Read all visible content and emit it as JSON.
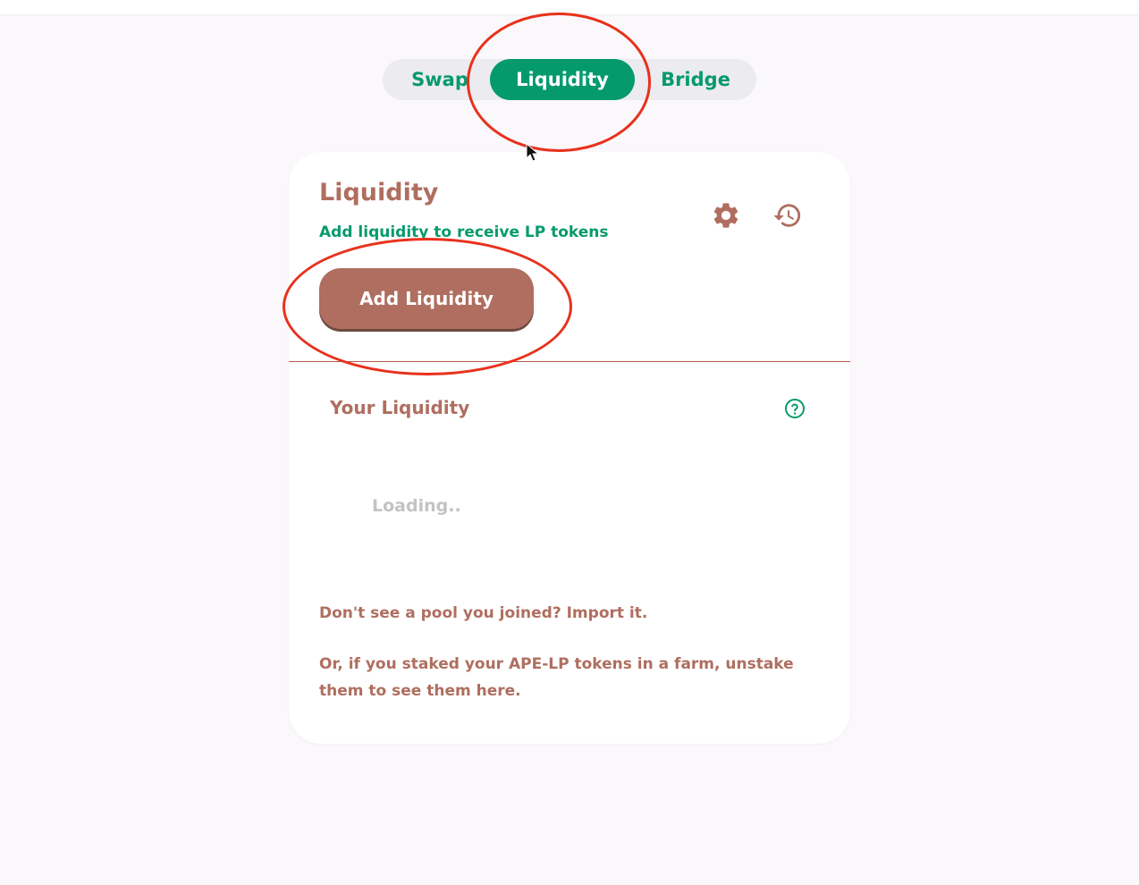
{
  "nav": {
    "tabs": [
      {
        "label": "Swap",
        "active": false
      },
      {
        "label": "Liquidity",
        "active": true
      },
      {
        "label": "Bridge",
        "active": false
      }
    ]
  },
  "card": {
    "title": "Liquidity",
    "subtitle": "Add liquidity to receive LP tokens",
    "add_button_label": "Add Liquidity",
    "your_liquidity_label": "Your Liquidity",
    "loading_text": "Loading..",
    "import_prefix": "Don't see a pool you joined? ",
    "import_link": "Import it.",
    "staked_text": "Or, if you staked your APE-LP tokens in a farm, unstake them to see them here."
  },
  "icons": {
    "settings": "gear-icon",
    "history": "history-icon",
    "help": "question-circle-icon"
  },
  "colors": {
    "brand_green": "#049a6b",
    "brand_brown": "#af6e5f",
    "annotation_red": "#e8311c",
    "loading_gray": "#c3c3c3"
  }
}
